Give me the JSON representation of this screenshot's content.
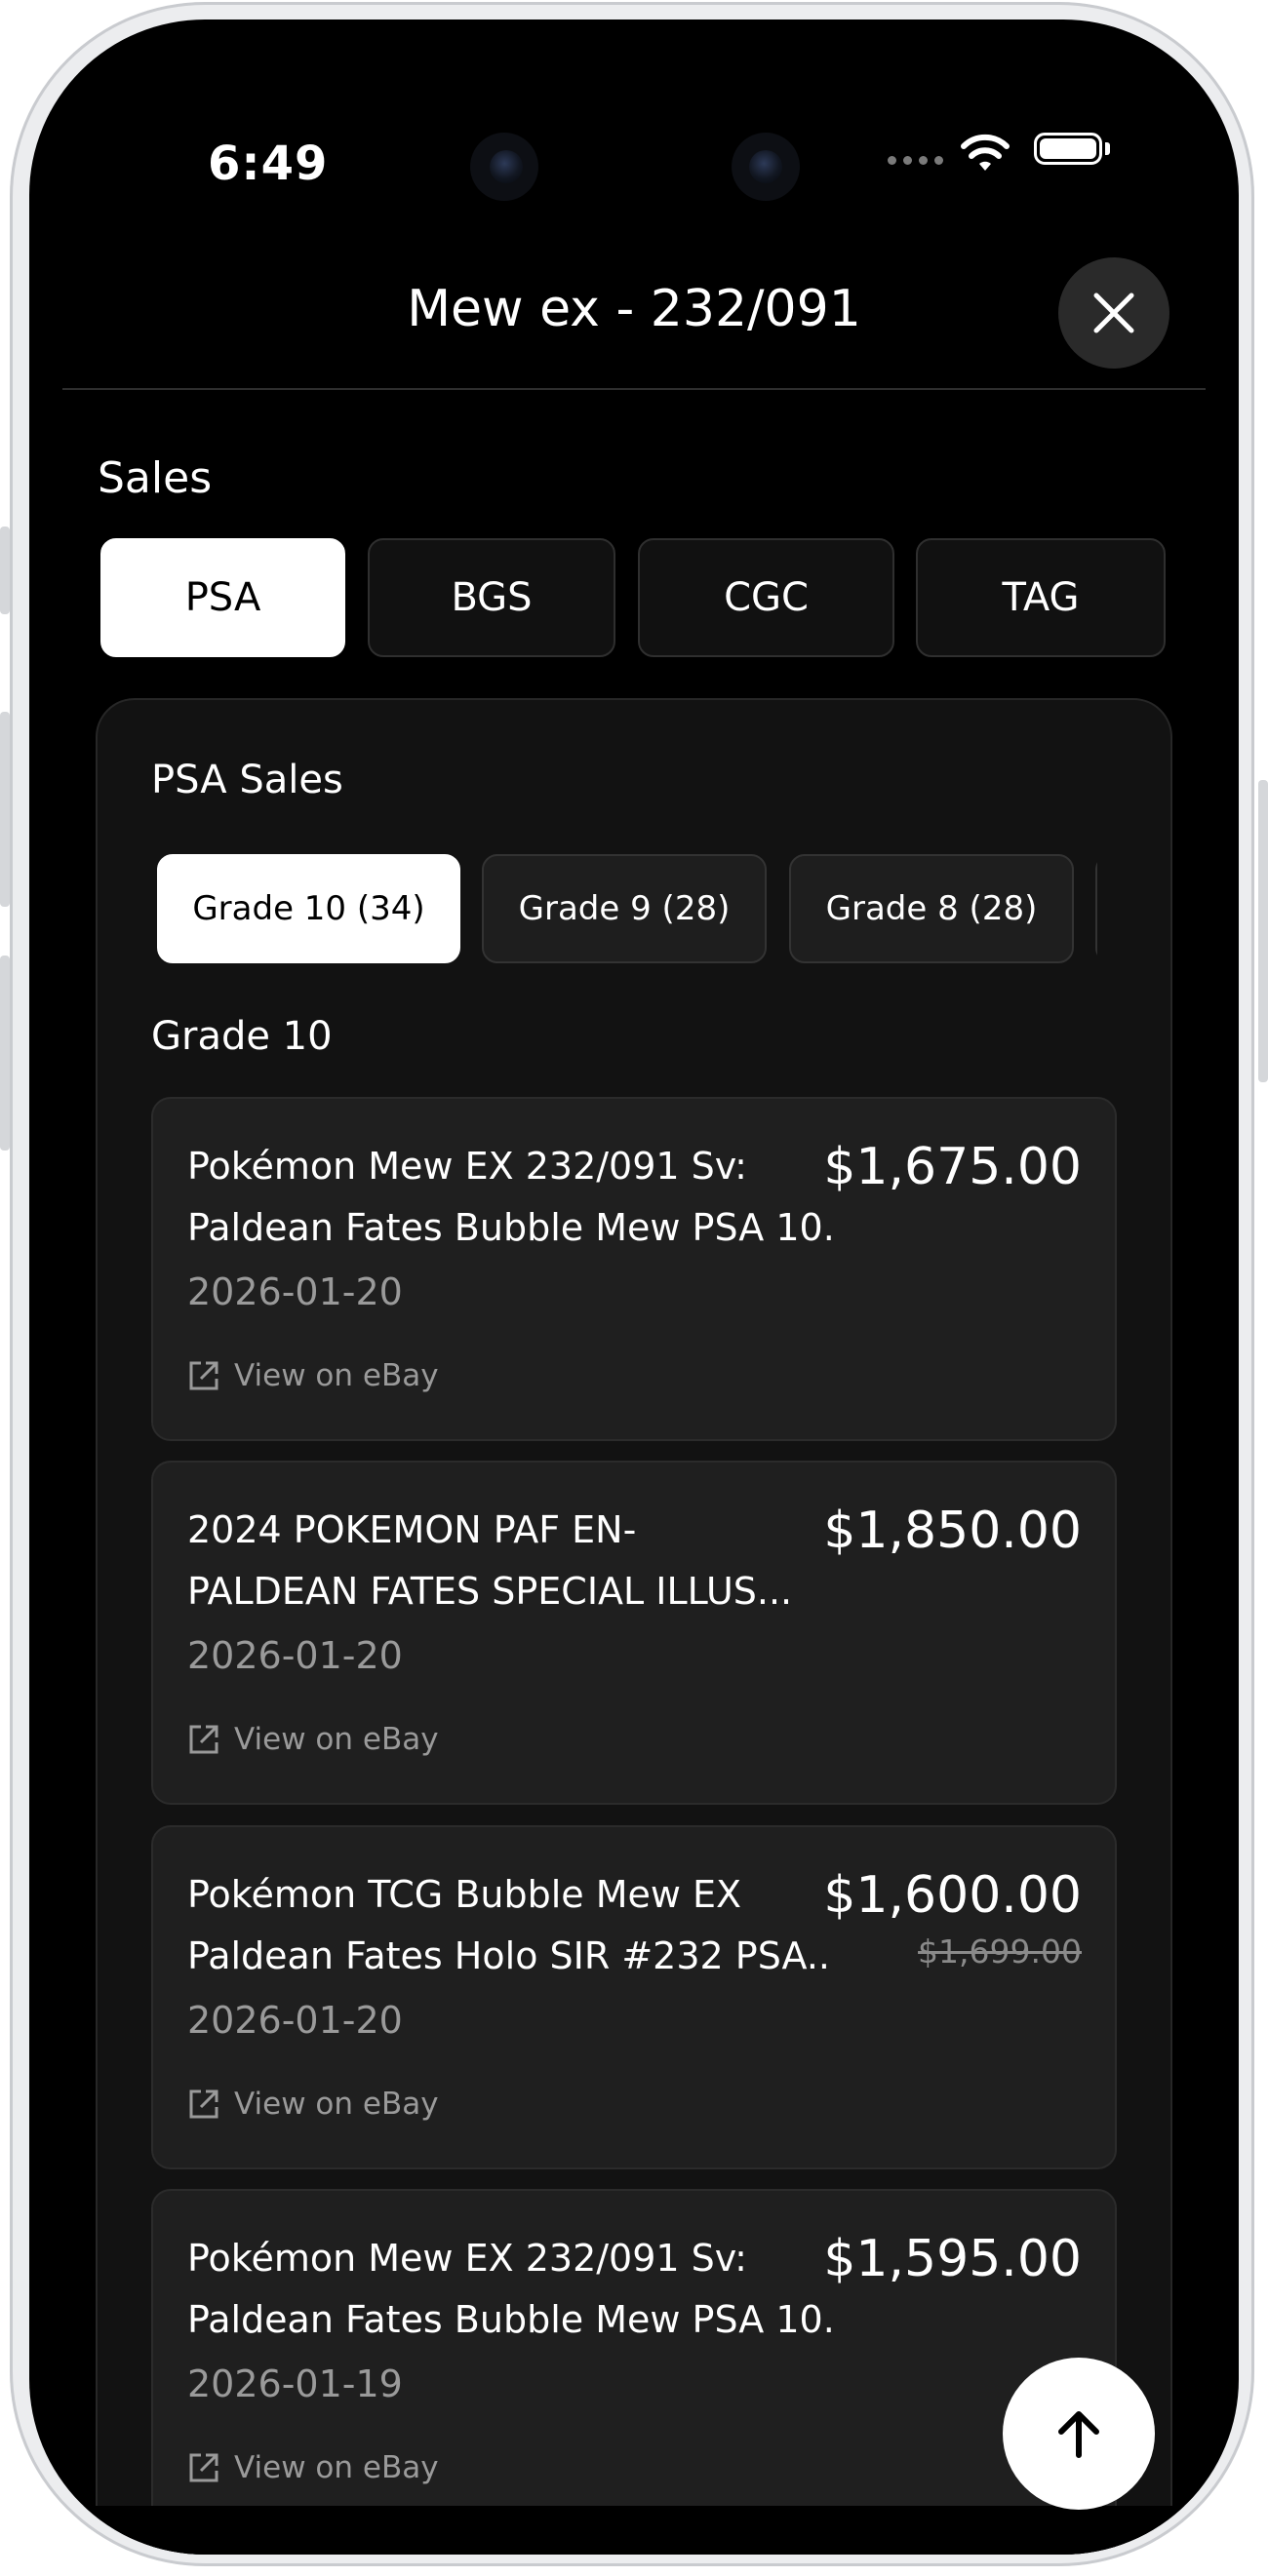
{
  "status_bar": {
    "time": "6:49"
  },
  "header": {
    "title": "Mew ex - 232/091"
  },
  "sales_section": {
    "label": "Sales",
    "grader_tabs": [
      {
        "label": "PSA",
        "active": true
      },
      {
        "label": "BGS",
        "active": false
      },
      {
        "label": "CGC",
        "active": false
      },
      {
        "label": "TAG",
        "active": false
      }
    ]
  },
  "sales_card": {
    "title": "PSA Sales",
    "grade_tabs": [
      {
        "label": "Grade 10 (34)",
        "active": true
      },
      {
        "label": "Grade 9 (28)",
        "active": false
      },
      {
        "label": "Grade 8 (28)",
        "active": false
      }
    ],
    "grade_heading": "Grade 10",
    "link_label": "View on eBay",
    "sales": [
      {
        "title_line1": "Pokémon Mew EX 232/091 Sv:",
        "title_line2": "Paldean Fates Bubble Mew PSA 10...",
        "price": "$1,675.00",
        "old_price": "",
        "date": "2026-01-20"
      },
      {
        "title_line1": "2024 POKEMON PAF EN-",
        "title_line2": "PALDEAN FATES SPECIAL ILLUS...",
        "price": "$1,850.00",
        "old_price": "",
        "date": "2026-01-20"
      },
      {
        "title_line1": "Pokémon TCG Bubble Mew EX",
        "title_line2": "Paldean Fates Holo SIR #232 PSA...",
        "price": "$1,600.00",
        "old_price": "$1,699.00",
        "date": "2026-01-20"
      },
      {
        "title_line1": "Pokémon Mew EX 232/091 Sv:",
        "title_line2": "Paldean Fates Bubble Mew PSA 10...",
        "price": "$1,595.00",
        "old_price": "",
        "date": "2026-01-19"
      }
    ]
  },
  "colors": {
    "background": "#000000",
    "card": "#1f1f1f",
    "accent": "#ffffff",
    "muted_text": "#9a9a9a"
  },
  "icons": {
    "close": "close-icon",
    "external_link": "external-link-icon",
    "scroll_top": "arrow-up-icon"
  }
}
